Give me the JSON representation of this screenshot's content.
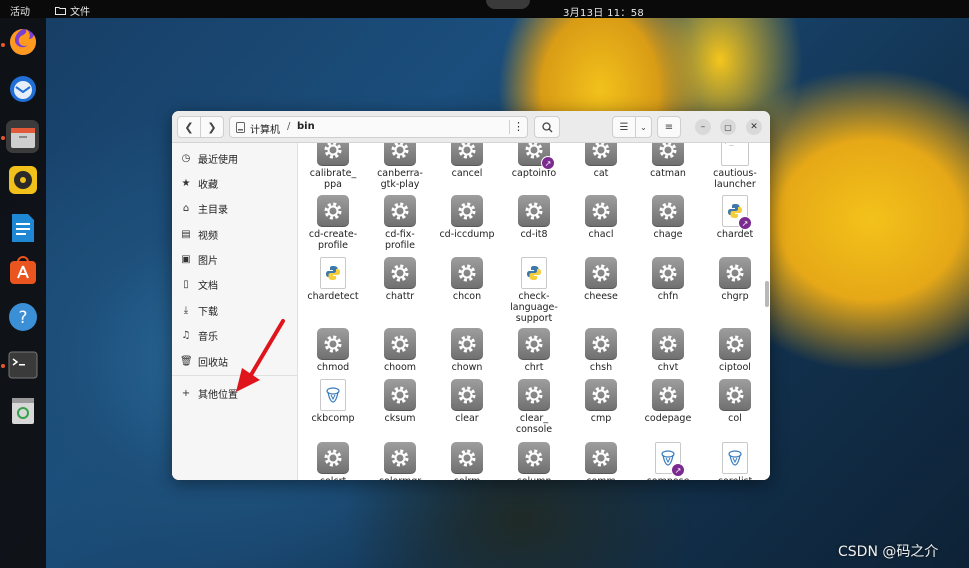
{
  "topbar": {
    "activities": "活动",
    "app_menu": "文件",
    "clock": "3月13日  11：58"
  },
  "dock": [
    {
      "name": "firefox-icon",
      "active": true
    },
    {
      "name": "thunderbird-icon",
      "active": false
    },
    {
      "name": "files-icon",
      "active": true
    },
    {
      "name": "rhythmbox-icon",
      "active": false
    },
    {
      "name": "writer-icon",
      "active": false
    },
    {
      "name": "software-icon",
      "active": false
    },
    {
      "name": "help-icon",
      "active": false
    },
    {
      "name": "terminal-icon",
      "active": true
    },
    {
      "name": "trash-icon",
      "active": false
    }
  ],
  "window": {
    "path": {
      "parent": "计算机",
      "separator": "/",
      "current": "bin"
    },
    "sidebar": [
      {
        "icon": "clock-icon",
        "label": "最近使用"
      },
      {
        "icon": "star-icon",
        "label": "收藏"
      },
      {
        "icon": "home-icon",
        "label": "主目录"
      },
      {
        "icon": "video-icon",
        "label": "视频"
      },
      {
        "icon": "image-icon",
        "label": "图片"
      },
      {
        "icon": "document-icon",
        "label": "文档"
      },
      {
        "icon": "download-icon",
        "label": "下载"
      },
      {
        "icon": "music-icon",
        "label": "音乐"
      },
      {
        "icon": "trash-icon",
        "label": "回收站"
      },
      {
        "icon": "plus-icon",
        "label": "其他位置"
      }
    ],
    "files": [
      [
        {
          "name": "calibrate_\nppa",
          "type": "exec"
        },
        {
          "name": "canberra-\ngtk-play",
          "type": "exec"
        },
        {
          "name": "cancel",
          "type": "exec"
        },
        {
          "name": "captoinfo",
          "type": "link"
        },
        {
          "name": "cat",
          "type": "exec"
        },
        {
          "name": "catman",
          "type": "exec"
        },
        {
          "name": "cautious-\nlauncher",
          "type": "script"
        }
      ],
      [
        {
          "name": "cd-create-\nprofile",
          "type": "exec"
        },
        {
          "name": "cd-fix-\nprofile",
          "type": "exec"
        },
        {
          "name": "cd-iccdump",
          "type": "exec"
        },
        {
          "name": "cd-it8",
          "type": "exec"
        },
        {
          "name": "chacl",
          "type": "exec"
        },
        {
          "name": "chage",
          "type": "exec"
        },
        {
          "name": "chardet",
          "type": "pylink"
        }
      ],
      [
        {
          "name": "chardetect",
          "type": "python"
        },
        {
          "name": "chattr",
          "type": "exec"
        },
        {
          "name": "chcon",
          "type": "exec"
        },
        {
          "name": "check-\nlanguage-\nsupport",
          "type": "python"
        },
        {
          "name": "cheese",
          "type": "exec"
        },
        {
          "name": "chfn",
          "type": "exec"
        },
        {
          "name": "chgrp",
          "type": "exec"
        }
      ],
      [
        {
          "name": "chmod",
          "type": "exec"
        },
        {
          "name": "choom",
          "type": "exec"
        },
        {
          "name": "chown",
          "type": "exec"
        },
        {
          "name": "chrt",
          "type": "exec"
        },
        {
          "name": "chsh",
          "type": "exec"
        },
        {
          "name": "chvt",
          "type": "exec"
        },
        {
          "name": "ciptool",
          "type": "exec"
        }
      ],
      [
        {
          "name": "ckbcomp",
          "type": "perl"
        },
        {
          "name": "cksum",
          "type": "exec"
        },
        {
          "name": "clear",
          "type": "exec"
        },
        {
          "name": "clear_\nconsole",
          "type": "exec"
        },
        {
          "name": "cmp",
          "type": "exec"
        },
        {
          "name": "codepage",
          "type": "exec"
        },
        {
          "name": "col",
          "type": "exec"
        }
      ],
      [
        {
          "name": "colcrt",
          "type": "exec"
        },
        {
          "name": "colormgr",
          "type": "exec"
        },
        {
          "name": "colrm",
          "type": "exec"
        },
        {
          "name": "column",
          "type": "exec"
        },
        {
          "name": "comm",
          "type": "exec"
        },
        {
          "name": "compose",
          "type": "perllink"
        },
        {
          "name": "corelist",
          "type": "perl"
        }
      ]
    ]
  },
  "watermark": "CSDN @码之介",
  "colors": {
    "dock": "#0e0e10",
    "link_badge": "#7b2a8f",
    "gear": "#8a8a8a",
    "annotation_arrow": "#e0141b"
  }
}
